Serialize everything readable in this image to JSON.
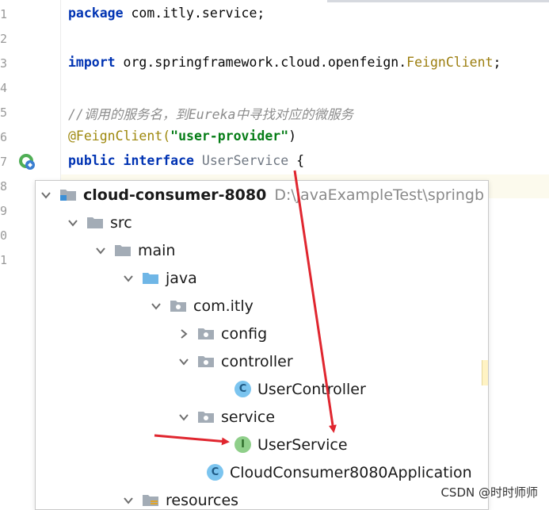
{
  "editor": {
    "line_numbers": [
      "1",
      "2",
      "3",
      "4",
      "5",
      "6",
      "7",
      "8",
      "9",
      "0",
      "1"
    ],
    "line1": {
      "kw": "package",
      "rest": " com.itly.service;"
    },
    "line3": {
      "kw": "import",
      "pkg": " org.springframework.cloud.openfeign.",
      "cls": "FeignClient",
      "end": ";"
    },
    "line5": {
      "comment": "//调用的服务名，到Eureka中寻找对应的微服务"
    },
    "line6": {
      "ann": "@FeignClient(",
      "str": "\"user-provider\"",
      "end": ")"
    },
    "line7": {
      "kw1": "public",
      "kw2": "interface",
      "name": "UserService",
      "end": " {"
    }
  },
  "tree": {
    "project": {
      "name": "cloud-consumer-8080",
      "path": "D:\\javaExampleTest\\springb"
    },
    "src": "src",
    "main": "main",
    "java": "java",
    "package": "com.itly",
    "config": "config",
    "controller": "controller",
    "user_controller": {
      "badge": "C",
      "label": "UserController"
    },
    "service": "service",
    "user_service": {
      "badge": "I",
      "label": "UserService"
    },
    "application": {
      "badge": "C",
      "label": "CloudConsumer8080Application"
    },
    "resources": "resources"
  },
  "colors": {
    "keyword": "#0033b3",
    "annotation": "#9e880d",
    "string": "#067d17",
    "arrow": "#e0262f",
    "folder": "#a3acb6",
    "java_folder": "#6fb6e6",
    "class_badge": "#7bc4ef",
    "interface_badge": "#8fcf8a"
  },
  "watermark": "CSDN @时时师师"
}
